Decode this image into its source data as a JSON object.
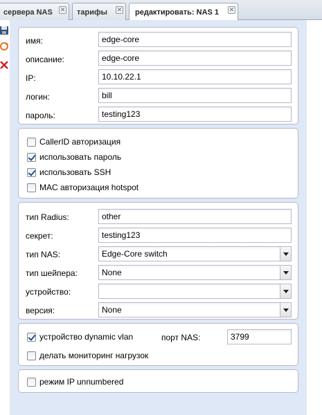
{
  "tabs": [
    {
      "label": "сервера NAS"
    },
    {
      "label": "тарифы"
    },
    {
      "label": "редактировать: NAS 1"
    }
  ],
  "tab_close_glyph": "✕",
  "toolbar_icons": [
    "save-icon",
    "refresh-icon",
    "delete-icon"
  ],
  "basic": {
    "name_label": "имя:",
    "name_value": "edge-core",
    "description_label": "описание:",
    "description_value": "edge-core",
    "ip_label": "IP:",
    "ip_value": "10.10.22.1",
    "login_label": "логин:",
    "login_value": "bill",
    "password_label": "пароль:",
    "password_value": "testing123"
  },
  "options": {
    "callerid_label": "CallerID авторизация",
    "callerid_checked": false,
    "use_password_label": "использовать пароль",
    "use_password_checked": true,
    "use_ssh_label": "использовать SSH",
    "use_ssh_checked": true,
    "mac_hotspot_label": "MAC авторизация hotspot",
    "mac_hotspot_checked": false
  },
  "radius": {
    "type_label": "тип Radius:",
    "type_value": "other",
    "secret_label": "секрет:",
    "secret_value": "testing123",
    "nas_type_label": "тип NAS:",
    "nas_type_value": "Edge-Core switch",
    "shaper_label": "тип шейпера:",
    "shaper_value": "None",
    "device_label": "устройство:",
    "device_value": "",
    "version_label": "версия:",
    "version_value": "None"
  },
  "vlan": {
    "dynamic_vlan_label": "устройство dynamic vlan",
    "dynamic_vlan_checked": true,
    "nas_port_label": "порт NAS:",
    "nas_port_value": "3799",
    "monitoring_label": "делать мониторинг нагрузок",
    "monitoring_checked": false
  },
  "unnumbered": {
    "label": "режим IP unnumbered",
    "checked": false
  }
}
